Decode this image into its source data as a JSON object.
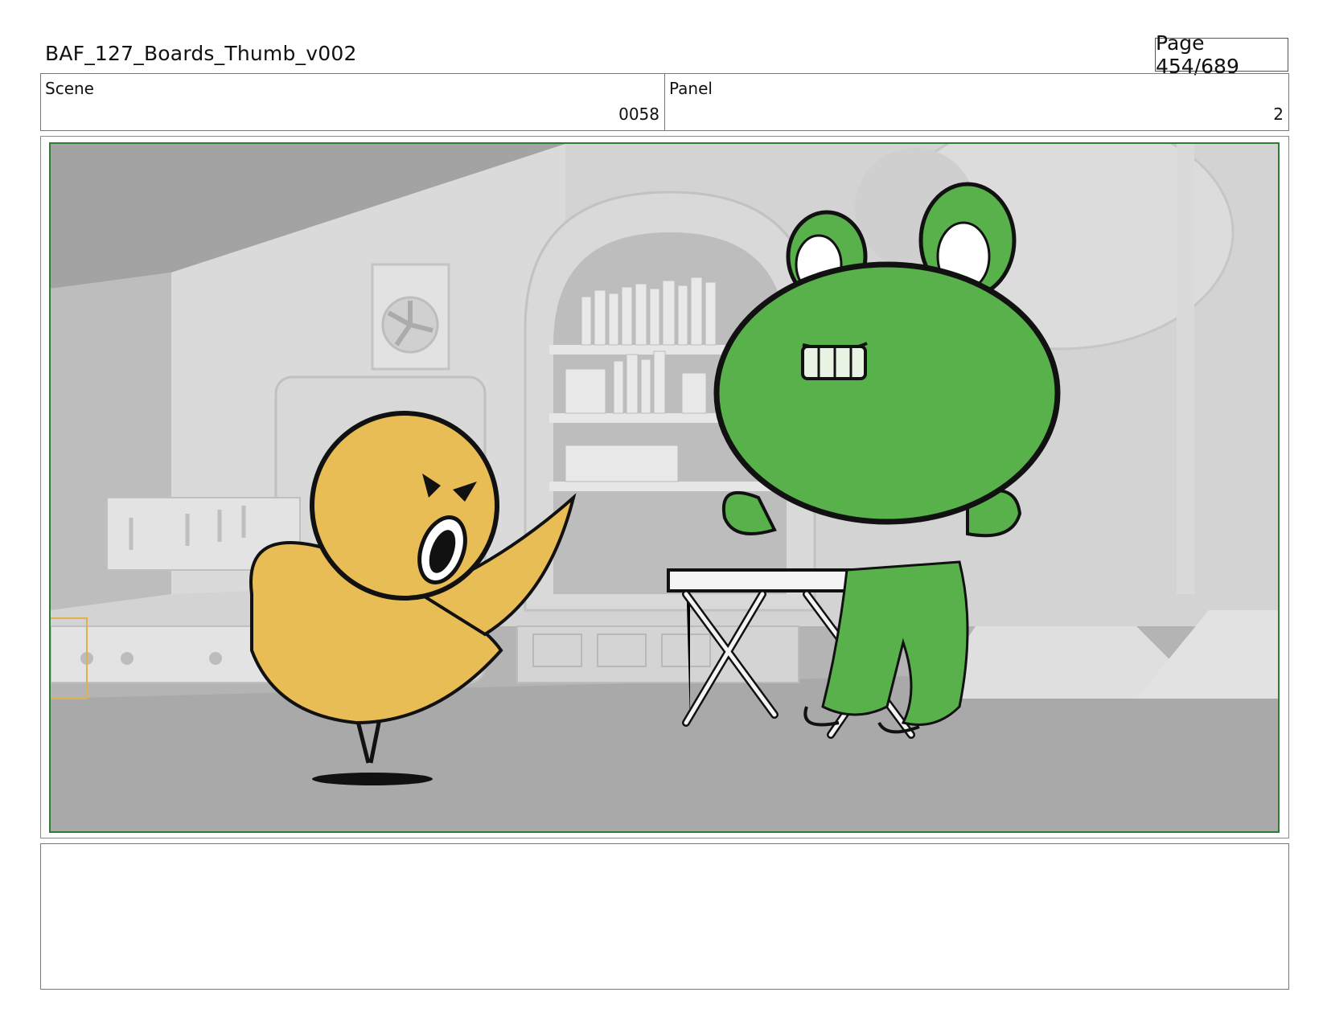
{
  "header": {
    "title": "BAF_127_Boards_Thumb_v002",
    "page_label": "Page 454/689"
  },
  "info": {
    "scene_label": "Scene",
    "scene_value": "0058",
    "panel_label": "Panel",
    "panel_value": "2"
  },
  "drawing": {
    "characters": [
      "yellow-chick",
      "green-frog"
    ],
    "props": [
      "folding-table",
      "bookshelf",
      "wall-fan",
      "cabinets"
    ],
    "colors": {
      "chick": "#e8bd55",
      "frog": "#58b14a",
      "frame_border": "#2e7d32"
    }
  },
  "notes": {
    "text": ""
  }
}
